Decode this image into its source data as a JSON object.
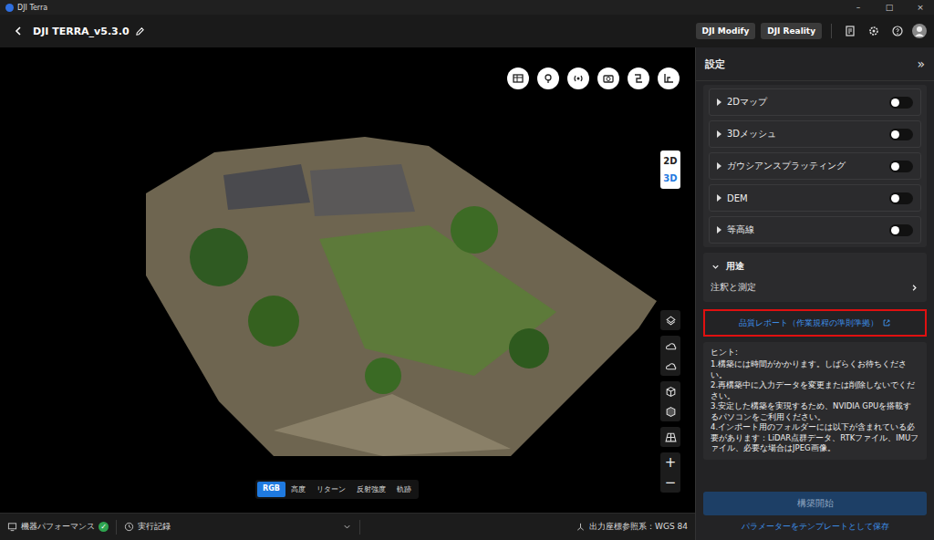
{
  "window": {
    "title": "DJI Terra",
    "controls": [
      "–",
      "□",
      "×"
    ]
  },
  "header": {
    "project": "DJI TERRA_v5.3.0",
    "buttons": [
      "DJI Modify",
      "DJI Reality"
    ]
  },
  "viewport": {
    "view_modes": [
      {
        "label": "2D",
        "selected": false
      },
      {
        "label": "3D",
        "selected": true
      }
    ],
    "zoom": [
      "+",
      "−"
    ],
    "color_modes": [
      {
        "label": "RGB",
        "selected": true
      },
      {
        "label": "高度",
        "selected": false
      },
      {
        "label": "リターン",
        "selected": false
      },
      {
        "label": "反射強度",
        "selected": false
      },
      {
        "label": "軌跡",
        "selected": false
      }
    ]
  },
  "settings": {
    "title": "設定",
    "collapse": "»",
    "outputs": [
      {
        "label": "2Dマップ",
        "expanded": false,
        "on": false
      },
      {
        "label": "3Dメッシュ",
        "expanded": false,
        "on": false
      },
      {
        "label": "ガウシアンスプラッティング",
        "expanded": false,
        "on": false
      },
      {
        "label": "DEM",
        "expanded": false,
        "on": false
      },
      {
        "label": "等高線",
        "expanded": false,
        "on": false
      }
    ],
    "usage": {
      "title": "用途",
      "expanded": true,
      "items": [
        "注釈と測定"
      ]
    },
    "report_link": {
      "label": "品質レポート（作業規程の準則準拠）",
      "highlighted": true
    },
    "hint": {
      "title": "ヒント:",
      "lines": [
        "1.構築には時間がかかります。しばらくお待ちください。",
        "2.再構築中に入力データを変更または削除しないでください。",
        "3.安定した構築を実現するため、NVIDIA GPUを搭載するパソコンをご利用ください。",
        "4.インポート用のフォルダーには以下が含まれている必要があります：LiDAR点群データ、RTKファイル、IMUファイル、必要な場合はJPEG画像。"
      ]
    },
    "build_button": {
      "label": "構築開始",
      "disabled": true
    },
    "template_link": "パラメーターをテンプレートとして保存"
  },
  "status_bar": {
    "performance": "機器パフォーマンス",
    "performance_ok": true,
    "history": "実行記録",
    "crs": "出力座標参照系：WGS 84"
  }
}
